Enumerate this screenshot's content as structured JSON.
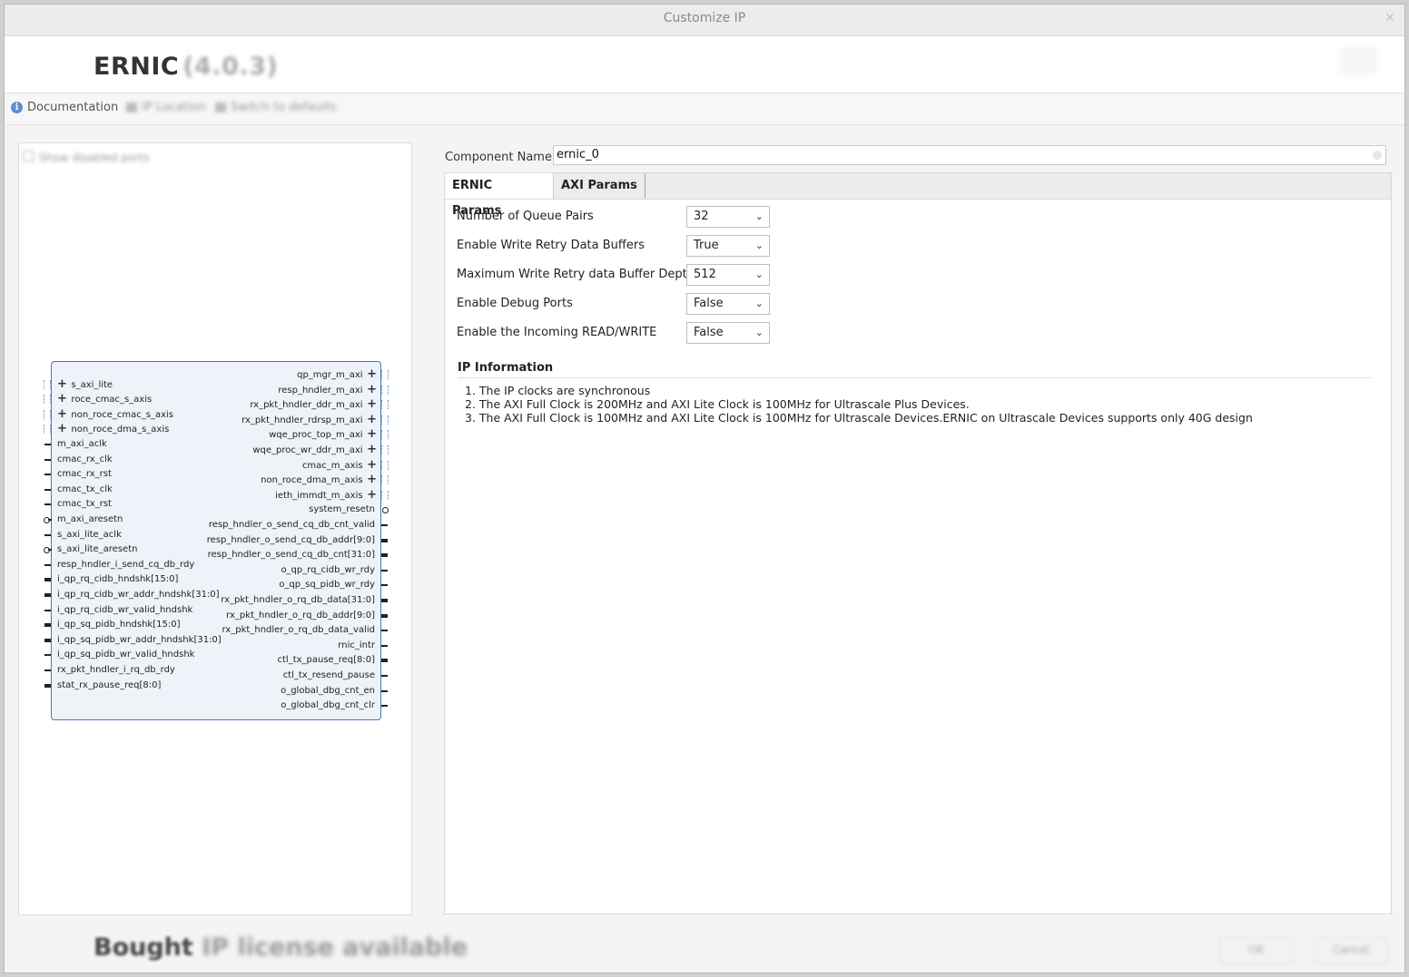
{
  "window": {
    "title": "Customize IP",
    "close_glyph": "✕"
  },
  "header": {
    "ip_name": "ERNIC",
    "ip_version": "(4.0.3)"
  },
  "toolbar": {
    "documentation": "Documentation",
    "ip_location": "IP Location",
    "switch_defaults": "Switch to defaults"
  },
  "symbol_panel": {
    "show_disabled_ports": "Show disabled ports",
    "left_ports": [
      {
        "label": "s_axi_lite",
        "kind": "bus_plus"
      },
      {
        "label": "roce_cmac_s_axis",
        "kind": "bus_plus"
      },
      {
        "label": "non_roce_cmac_s_axis",
        "kind": "bus_plus"
      },
      {
        "label": "non_roce_dma_s_axis",
        "kind": "bus_plus"
      },
      {
        "label": "m_axi_aclk",
        "kind": "wire"
      },
      {
        "label": "cmac_rx_clk",
        "kind": "wire"
      },
      {
        "label": "cmac_rx_rst",
        "kind": "wire"
      },
      {
        "label": "cmac_tx_clk",
        "kind": "wire"
      },
      {
        "label": "cmac_tx_rst",
        "kind": "wire"
      },
      {
        "label": "m_axi_aresetn",
        "kind": "bubble"
      },
      {
        "label": "s_axi_lite_aclk",
        "kind": "wire"
      },
      {
        "label": "s_axi_lite_aresetn",
        "kind": "bubble"
      },
      {
        "label": "resp_hndler_i_send_cq_db_rdy",
        "kind": "wire"
      },
      {
        "label": "i_qp_rq_cidb_hndshk[15:0]",
        "kind": "bus"
      },
      {
        "label": "i_qp_rq_cidb_wr_addr_hndshk[31:0]",
        "kind": "bus"
      },
      {
        "label": "i_qp_rq_cidb_wr_valid_hndshk",
        "kind": "wire"
      },
      {
        "label": "i_qp_sq_pidb_hndshk[15:0]",
        "kind": "bus"
      },
      {
        "label": "i_qp_sq_pidb_wr_addr_hndshk[31:0]",
        "kind": "bus"
      },
      {
        "label": "i_qp_sq_pidb_wr_valid_hndshk",
        "kind": "wire"
      },
      {
        "label": "rx_pkt_hndler_i_rq_db_rdy",
        "kind": "wire"
      },
      {
        "label": "stat_rx_pause_req[8:0]",
        "kind": "bus"
      }
    ],
    "right_ports": [
      {
        "label": "qp_mgr_m_axi",
        "kind": "bus_plus"
      },
      {
        "label": "resp_hndler_m_axi",
        "kind": "bus_plus"
      },
      {
        "label": "rx_pkt_hndler_ddr_m_axi",
        "kind": "bus_plus"
      },
      {
        "label": "rx_pkt_hndler_rdrsp_m_axi",
        "kind": "bus_plus"
      },
      {
        "label": "wqe_proc_top_m_axi",
        "kind": "bus_plus"
      },
      {
        "label": "wqe_proc_wr_ddr_m_axi",
        "kind": "bus_plus"
      },
      {
        "label": "cmac_m_axis",
        "kind": "bus_plus"
      },
      {
        "label": "non_roce_dma_m_axis",
        "kind": "bus_plus"
      },
      {
        "label": "ieth_immdt_m_axis",
        "kind": "bus_plus"
      },
      {
        "label": "system_resetn",
        "kind": "bubble"
      },
      {
        "label": "resp_hndler_o_send_cq_db_cnt_valid",
        "kind": "wire"
      },
      {
        "label": "resp_hndler_o_send_cq_db_addr[9:0]",
        "kind": "bus"
      },
      {
        "label": "resp_hndler_o_send_cq_db_cnt[31:0]",
        "kind": "bus"
      },
      {
        "label": "o_qp_rq_cidb_wr_rdy",
        "kind": "wire"
      },
      {
        "label": "o_qp_sq_pidb_wr_rdy",
        "kind": "wire"
      },
      {
        "label": "rx_pkt_hndler_o_rq_db_data[31:0]",
        "kind": "bus"
      },
      {
        "label": "rx_pkt_hndler_o_rq_db_addr[9:0]",
        "kind": "bus"
      },
      {
        "label": "rx_pkt_hndler_o_rq_db_data_valid",
        "kind": "wire"
      },
      {
        "label": "rnic_intr",
        "kind": "wire"
      },
      {
        "label": "ctl_tx_pause_req[8:0]",
        "kind": "bus"
      },
      {
        "label": "ctl_tx_resend_pause",
        "kind": "wire"
      },
      {
        "label": "o_global_dbg_cnt_en",
        "kind": "wire"
      },
      {
        "label": "o_global_dbg_cnt_clr",
        "kind": "wire"
      }
    ]
  },
  "config": {
    "component_name_label": "Component Name",
    "component_name_value": "ernic_0",
    "tabs": [
      {
        "label": "ERNIC Params",
        "active": true
      },
      {
        "label": "AXI Params",
        "active": false
      }
    ],
    "params": [
      {
        "label": "Number of Queue Pairs",
        "value": "32"
      },
      {
        "label": "Enable Write Retry Data Buffers",
        "value": "True"
      },
      {
        "label": "Maximum Write Retry data Buffer Depth",
        "value": "512"
      },
      {
        "label": "Enable Debug Ports",
        "value": "False"
      },
      {
        "label": "Enable the Incoming READ/WRITE",
        "value": "False"
      }
    ],
    "info_title": "IP Information",
    "info_items": [
      "1. The IP clocks are synchronous",
      "2. The AXI Full Clock is 200MHz and AXI Lite Clock is 100MHz for Ultrascale Plus Devices.",
      "3. The AXI Full Clock is 100MHz and AXI Lite Clock is 100MHz for Ultrascale Devices.ERNIC on Ultrascale Devices supports only 40G design"
    ]
  },
  "footer": {
    "license_strong": "Bought",
    "license_soft": "IP license available",
    "ok": "OK",
    "cancel": "Cancel"
  },
  "colors": {
    "block_fill": "#eef3fa",
    "block_border": "#4a78b8",
    "info_icon": "#5a8fd0"
  }
}
